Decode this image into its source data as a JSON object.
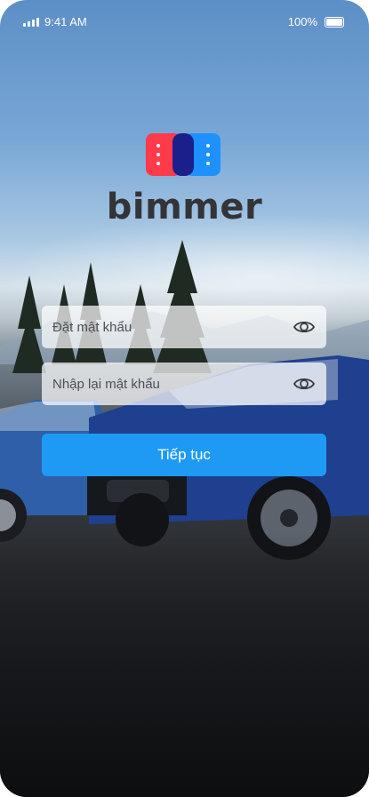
{
  "status_bar": {
    "time": "9:41 AM",
    "battery": "100%"
  },
  "brand": {
    "name": "bimmer"
  },
  "form": {
    "password_placeholder": "Đặt mật khẩu",
    "confirm_placeholder": "Nhập lại mật khẩu",
    "submit_label": "Tiếp tục"
  },
  "icons": {
    "signal": "signal-icon",
    "battery": "battery-icon",
    "logo": "bimmer-logo",
    "eye": "eye-icon"
  },
  "colors": {
    "primary": "#1e9af5",
    "logo_red": "#ff3b4a",
    "logo_blue": "#1e90ff",
    "logo_navy": "#1a1f8c",
    "brand_text": "#333438"
  }
}
